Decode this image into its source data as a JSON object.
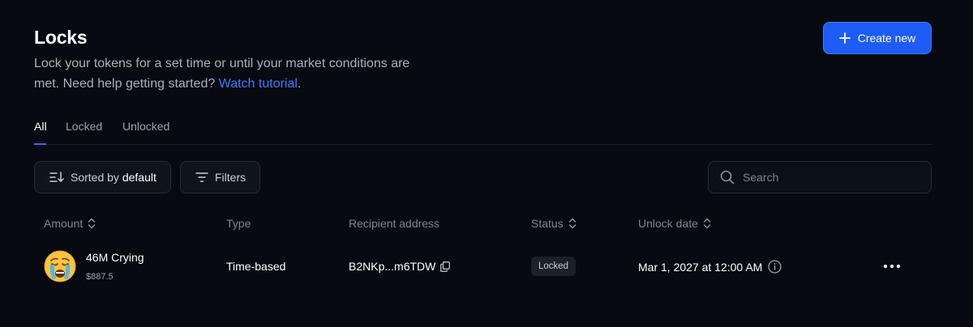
{
  "header": {
    "title": "Locks",
    "description": "Lock your tokens for a set time or until your market conditions are met. Need help getting started?",
    "tutorial_link": "Watch tutorial",
    "create_label": "Create new"
  },
  "tabs": [
    {
      "label": "All",
      "active": true
    },
    {
      "label": "Locked",
      "active": false
    },
    {
      "label": "Unlocked",
      "active": false
    }
  ],
  "controls": {
    "sort_prefix": "Sorted by",
    "sort_value": "default",
    "filters_label": "Filters",
    "search_placeholder": "Search"
  },
  "table": {
    "columns": [
      "Amount",
      "Type",
      "Recipient address",
      "Status",
      "Unlock date"
    ],
    "rows": [
      {
        "token_name": "46M Crying",
        "token_value": "$887.5",
        "type": "Time-based",
        "recipient": "B2NKp...m6TDW",
        "status": "Locked",
        "unlock_date": "Mar 1, 2027 at 12:00 AM"
      }
    ]
  },
  "colors": {
    "background": "#070a11",
    "accent": "#1d5cf5",
    "link": "#3d7bff"
  }
}
